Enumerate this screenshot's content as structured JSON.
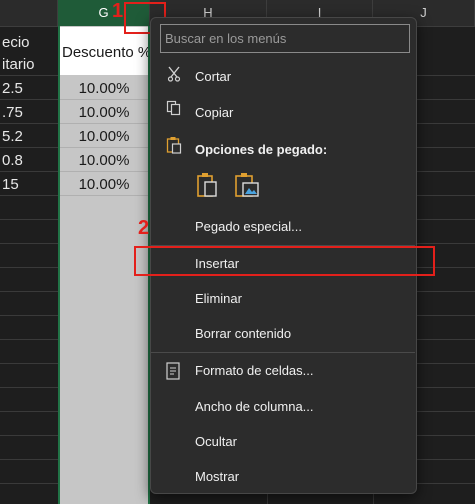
{
  "sheet": {
    "columns": [
      "G",
      "H",
      "I",
      "J"
    ],
    "left_col_texts": [
      "ecio",
      "itario",
      "2.5",
      ".75",
      "5.2",
      "0.8",
      "15"
    ],
    "g_header": "Descuento %",
    "g_values": [
      "10.00%",
      "10.00%",
      "10.00%",
      "10.00%",
      "10.00%"
    ]
  },
  "annotations": {
    "step1": "1",
    "step2": "2"
  },
  "menu": {
    "search_placeholder": "Buscar en los menús",
    "items": {
      "cut": "Cortar",
      "copy": "Copiar",
      "paste_options": "Opciones de pegado:",
      "paste_special": "Pegado especial...",
      "insert": "Insertar",
      "delete": "Eliminar",
      "clear": "Borrar contenido",
      "format": "Formato de celdas...",
      "width": "Ancho de columna...",
      "hide": "Ocultar",
      "show": "Mostrar"
    }
  },
  "colors": {
    "accent_green": "#217346",
    "annotation_red": "#e3201b"
  }
}
